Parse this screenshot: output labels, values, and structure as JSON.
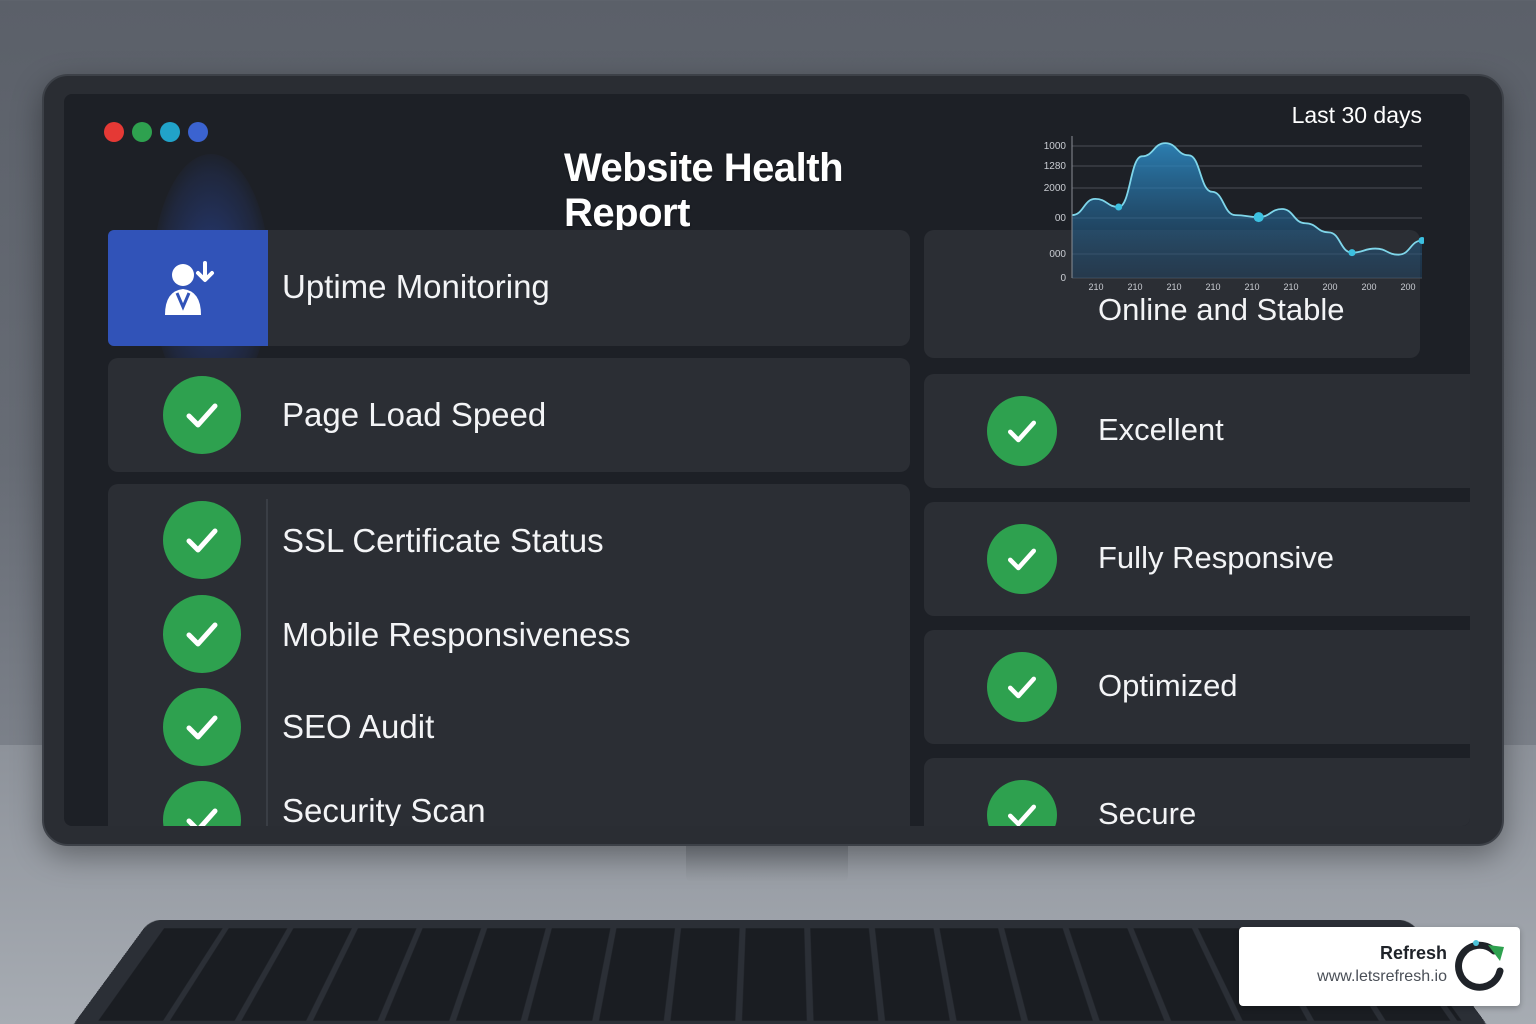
{
  "header": {
    "title": "Website Health Report",
    "window_dot_colors": [
      "#e53935",
      "#2ea14f",
      "#21a3c9",
      "#3b63d0"
    ]
  },
  "checks": [
    {
      "label": "Uptime Monitoring",
      "icon": "user-download-icon",
      "status": "Online and Stable"
    },
    {
      "label": "Page Load Speed",
      "icon": "check-icon",
      "status": "Excellent"
    },
    {
      "label": "SSL Certificate Status",
      "icon": "check-icon",
      "status": "Fully Responsive"
    },
    {
      "label": "Mobile Responsiveness",
      "icon": "check-icon",
      "status": "Optimized"
    },
    {
      "label": "SEO Audit",
      "icon": "check-icon",
      "status": "Secure"
    },
    {
      "label": "Security Scan",
      "icon": "check-icon"
    }
  ],
  "chart_data": {
    "type": "area",
    "title": "Last 30 days",
    "ytick_labels": [
      "0",
      "000",
      "00",
      "2000",
      "1280",
      "1000"
    ],
    "xtick_labels": [
      "210",
      "210",
      "210",
      "210",
      "210",
      "210",
      "200",
      "200",
      "200"
    ],
    "ylim": [
      0,
      1000
    ],
    "values": [
      620,
      780,
      700,
      1200,
      1330,
      1210,
      850,
      620,
      600,
      680,
      540,
      450,
      250,
      290,
      230,
      370
    ],
    "marker_indices": [
      2,
      8,
      12,
      15
    ],
    "color": "#2e8ec9"
  },
  "brand": {
    "name": "Refresh",
    "url": "www.letsrefresh.io",
    "accent": "#2ea14f"
  },
  "colors": {
    "check": "#2ea14f",
    "uptime_icon_bg": "#3153b8",
    "panel": "#2b2e34",
    "screen": "#1d2026"
  }
}
